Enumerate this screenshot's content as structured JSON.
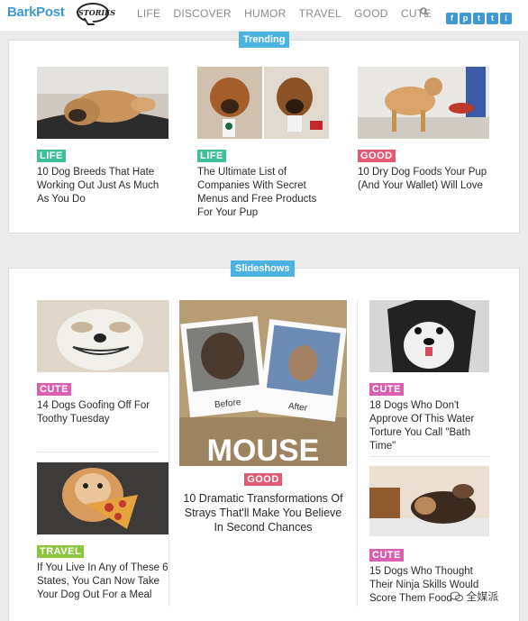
{
  "header": {
    "logo": "BarkPost",
    "stories_badge": "STORIES",
    "nav": [
      "LIFE",
      "DISCOVER",
      "HUMOR",
      "TRAVEL",
      "GOOD",
      "CUTE"
    ],
    "social": [
      "f",
      "p",
      "t",
      "t",
      "i"
    ]
  },
  "trending": {
    "label": "Trending",
    "cards": [
      {
        "tag": "LIFE",
        "title": "10 Dog Breeds That Hate Working Out Just As Much As You Do"
      },
      {
        "tag": "LIFE",
        "title": "The Ultimate List of Companies With Secret Menus and Free Products For Your Pup"
      },
      {
        "tag": "GOOD",
        "title": "10 Dry Dog Foods Your Pup (And Your Wallet) Will Love"
      }
    ]
  },
  "slideshows": {
    "label": "Slideshows",
    "cards": [
      {
        "tag": "CUTE",
        "title": "14 Dogs Goofing Off For Toothy Tuesday"
      },
      {
        "tag": "TRAVEL",
        "title": "If You Live In Any of These 6 States, You Can Now Take Your Dog Out For a Meal"
      },
      {
        "tag": "GOOD",
        "title": "10 Dramatic Transformations Of Strays That'll Make You Believe In Second Chances"
      },
      {
        "tag": "CUTE",
        "title": "18 Dogs Who Don't Approve Of This Water Torture You Call \"Bath Time\""
      },
      {
        "tag": "CUTE",
        "title": "15 Dogs Who Thought Their Ninja Skills Would Score Them Food"
      }
    ],
    "feature_image": {
      "before": "Before",
      "after": "After",
      "name": "MOUSE"
    }
  },
  "watermark": "全媒派",
  "colors": {
    "accent": "#4ab3e2",
    "life": "#3fbf9a",
    "good": "#e35a74",
    "cute": "#d95fb0",
    "travel": "#8cc63f"
  }
}
